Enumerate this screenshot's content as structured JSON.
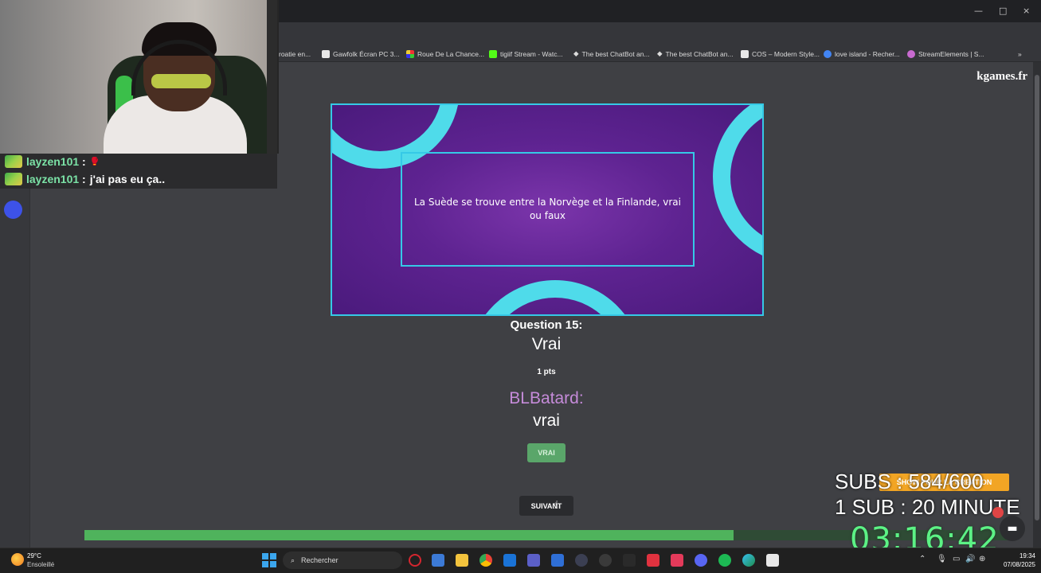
{
  "window": {
    "minimize": "—",
    "maximize": "□",
    "close": "×"
  },
  "bookmarks": [
    {
      "label": "roatie en...",
      "color": "#8a8a8a"
    },
    {
      "label": "Gawfolk Écran PC 3...",
      "color": "#e8e8e8"
    },
    {
      "label": "Roue De La Chance...",
      "color": "#d03c8a"
    },
    {
      "label": "tigiif Stream - Watc...",
      "color": "#53fc18"
    },
    {
      "label": "The best ChatBot an...",
      "color": "#ffffff"
    },
    {
      "label": "The best ChatBot an...",
      "color": "#ffffff"
    },
    {
      "label": "COS – Modern Style...",
      "color": "#e8e8e8"
    },
    {
      "label": "love island - Recher...",
      "color": "#4285f4"
    },
    {
      "label": "StreamElements | S...",
      "color": "#c86ad0"
    }
  ],
  "bookmarks_more": "»",
  "site_logo": "kgames.fr",
  "question_card": {
    "question_text": "La Suède se trouve entre la Norvège et la Finlande, vrai ou faux"
  },
  "result": {
    "question_label": "Question 15:",
    "correct_answer": "Vrai",
    "points": "1 pts",
    "player_name": "BLBatard:",
    "player_answer": "vrai",
    "verdict_button": "VRAI",
    "next_button": "SUIVANT"
  },
  "progress": {
    "fraction": 0.703
  },
  "chat": [
    {
      "user": "layzen101",
      "sep": " :",
      "message": "🥊"
    },
    {
      "user": "layzen101",
      "sep": " :",
      "message": "j'ai pas eu ça.."
    }
  ],
  "stream_overlay": {
    "sub_goal_tag": "SHOW POUR LA CREATION",
    "subs_count": "SUBS : 584/600",
    "sub_rule": "1 SUB :  20 MINUTE",
    "timer": "03:16:42"
  },
  "taskbar": {
    "weather_temp": "29°C",
    "weather_desc": "Ensoleillé",
    "search_placeholder": "Rechercher",
    "time": "19:34",
    "date": "07/08/2025"
  }
}
